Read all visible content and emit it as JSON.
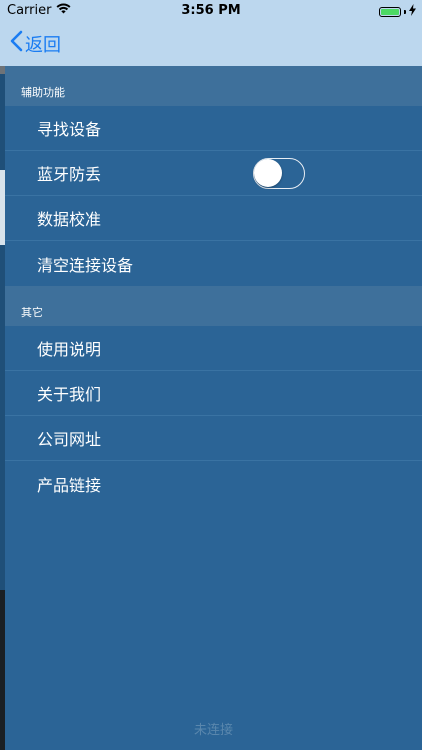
{
  "status_bar": {
    "carrier": "Carrier",
    "time": "3:56 PM"
  },
  "nav": {
    "back_label": "返回"
  },
  "sections": [
    {
      "header": "辅助功能",
      "items": [
        "寻找设备",
        "蓝牙防丢",
        "数据校准",
        "清空连接设备"
      ]
    },
    {
      "header": "其它",
      "items": [
        "使用说明",
        "关于我们",
        "公司网址",
        "产品链接"
      ]
    }
  ],
  "bluetooth_antilost_toggle": {
    "on": false
  },
  "footer": {
    "connection_status": "未连接"
  },
  "colors": {
    "accent": "#1a7cf2",
    "menu_background": "#2b6496",
    "header_background": "#3e709b",
    "battery": "#4cd964"
  }
}
